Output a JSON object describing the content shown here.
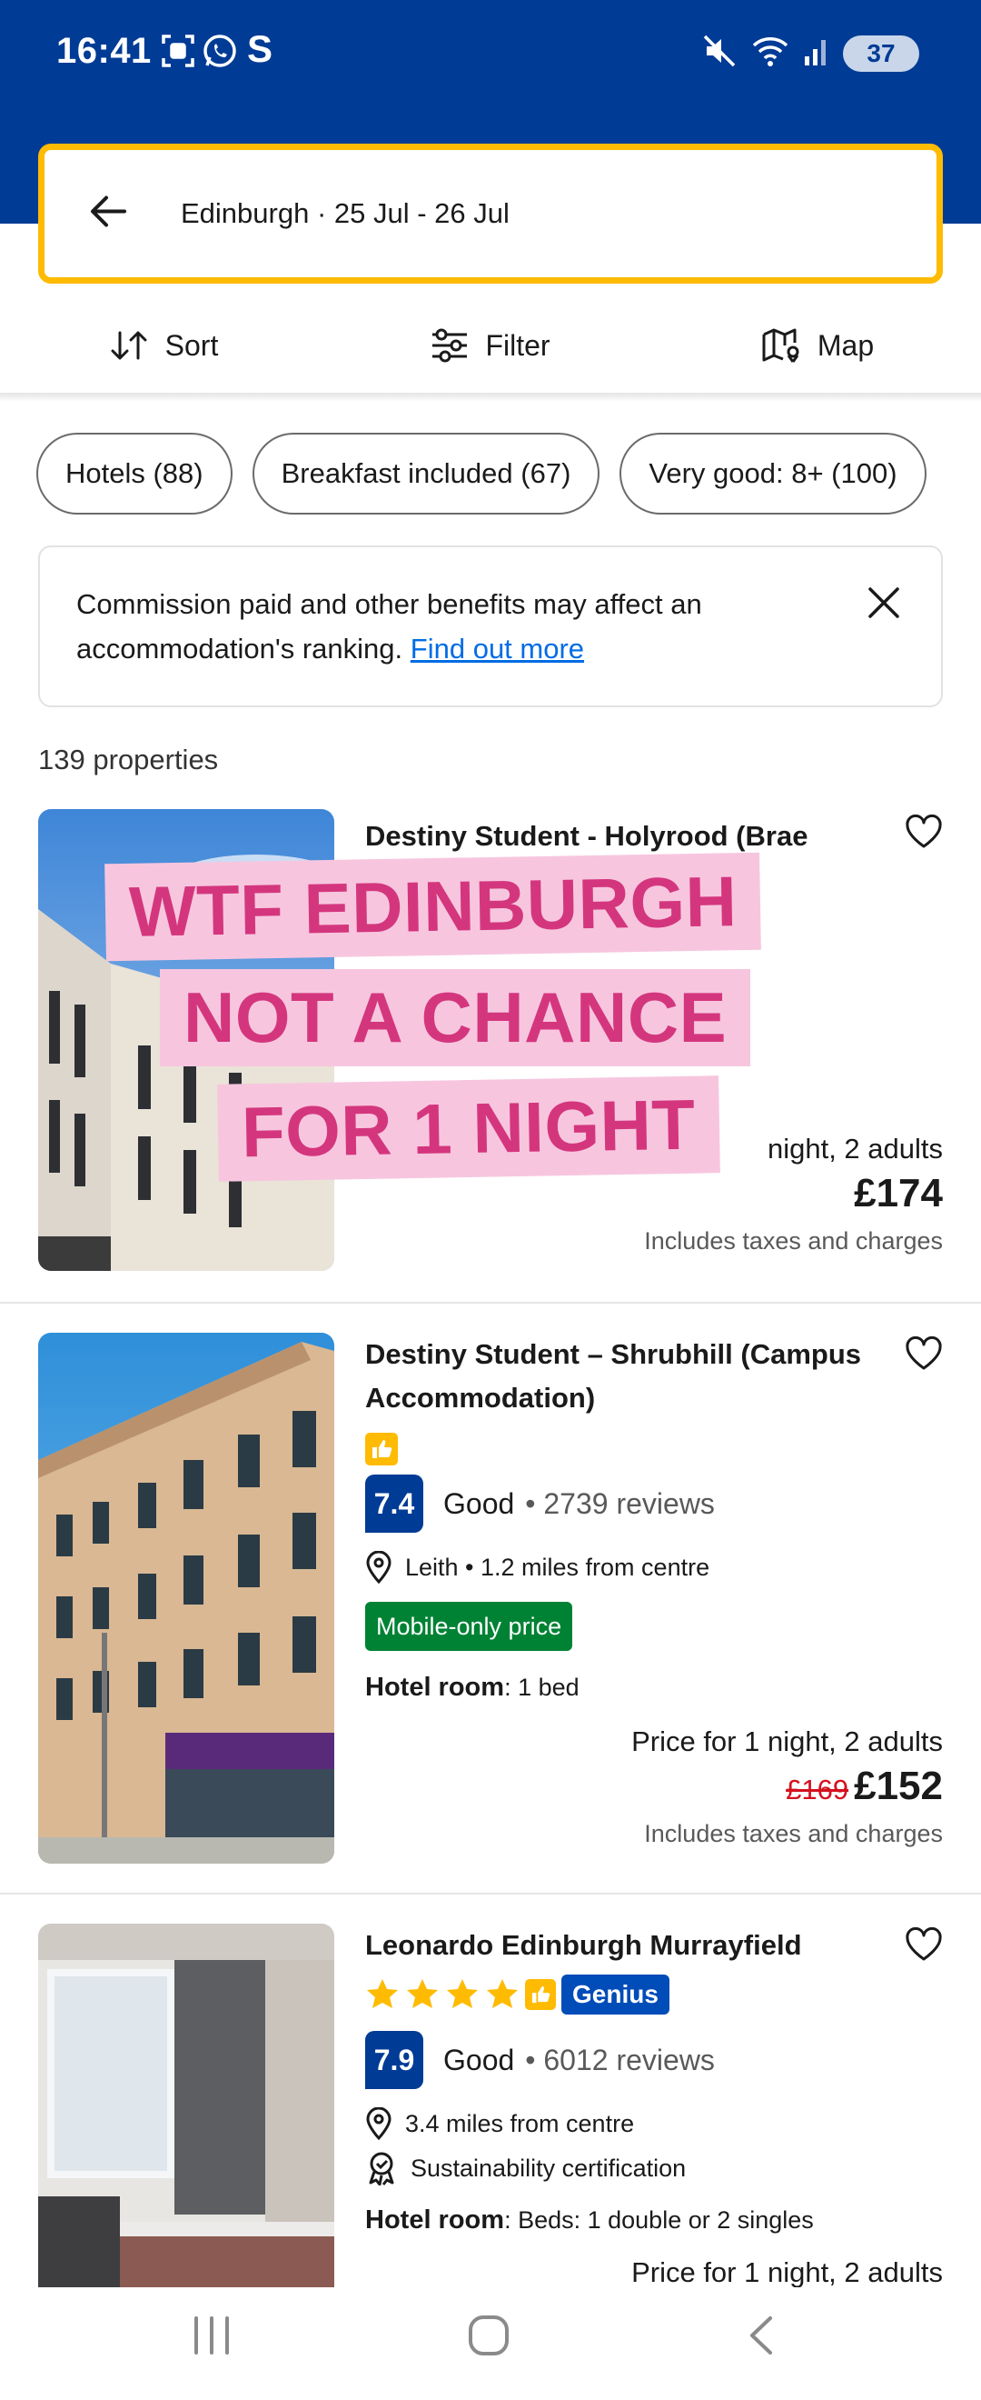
{
  "status_bar": {
    "time": "16:41",
    "battery": "37"
  },
  "search": {
    "query": "Edinburgh · 25 Jul - 26 Jul"
  },
  "toolbar": {
    "sort_label": "Sort",
    "filter_label": "Filter",
    "map_label": "Map"
  },
  "chips": [
    {
      "label": "Hotels (88)"
    },
    {
      "label": "Breakfast included (67)"
    },
    {
      "label": "Very good: 8+ (100)"
    }
  ],
  "notice": {
    "text": "Commission paid and other benefits may affect an accommodation's ranking.",
    "link": "Find out more"
  },
  "results": {
    "count": "139 properties"
  },
  "overlay": {
    "line1": "WTF EDINBURGH",
    "line2": "NOT A CHANCE",
    "line3": "FOR 1 NIGHT"
  },
  "properties": [
    {
      "name": "Destiny Student - Holyrood (Brae",
      "price_for_partial": "night, 2 adults",
      "price": "£174",
      "taxes": "Includes taxes and charges"
    },
    {
      "name": "Destiny Student – Shrubhill (Campus Accommodation)",
      "score": "7.4",
      "rating_word": "Good",
      "reviews": "• 2739 reviews",
      "location": "Leith • 1.2 miles from centre",
      "badge": "Mobile-only price",
      "room_type": "Hotel room",
      "room_detail": ": 1 bed",
      "price_for": "Price for 1 night, 2 adults",
      "old_price": "£169",
      "price": "£152",
      "taxes": "Includes taxes and charges"
    },
    {
      "name": "Leonardo Edinburgh Murrayfield",
      "stars": 4,
      "genius": "Genius",
      "score": "7.9",
      "rating_word": "Good",
      "reviews": "• 6012 reviews",
      "location": "3.4 miles from centre",
      "certification": "Sustainability certification",
      "room_type": "Hotel room",
      "room_detail": ": Beds: 1 double or 2 singles",
      "price_for": "Price for 1 night, 2 adults"
    }
  ],
  "colors": {
    "brand_blue": "#003b95",
    "search_border": "#febb02",
    "link": "#006ce4",
    "green_badge": "#008234",
    "discount_red": "#d4111e",
    "sticker_text": "#d4367e",
    "sticker_bg": "#f7c6de"
  }
}
